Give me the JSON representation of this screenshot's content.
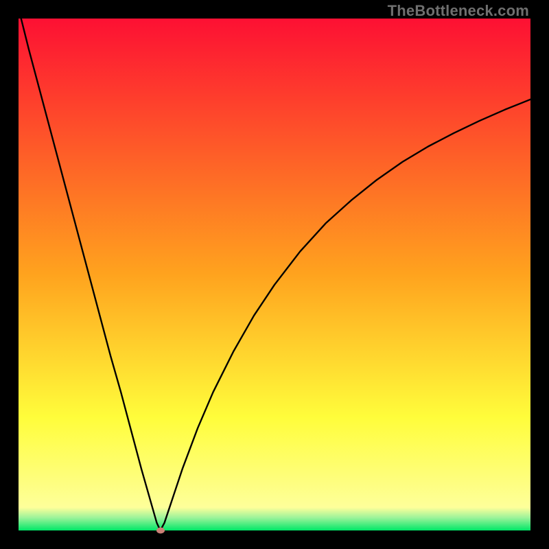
{
  "watermark": "TheBottleneck.com",
  "chart_data": {
    "type": "line",
    "title": "",
    "xlabel": "",
    "ylabel": "",
    "xlim": [
      0,
      100
    ],
    "ylim": [
      0,
      100
    ],
    "grid": false,
    "legend": false,
    "background": {
      "gradient_stops": [
        {
          "pos": 0.0,
          "color": "#fd1033"
        },
        {
          "pos": 0.5,
          "color": "#ffa31e"
        },
        {
          "pos": 0.78,
          "color": "#fffd3b"
        },
        {
          "pos": 0.955,
          "color": "#feff9a"
        },
        {
          "pos": 0.975,
          "color": "#9cf39a"
        },
        {
          "pos": 1.0,
          "color": "#00e767"
        }
      ]
    },
    "series": [
      {
        "name": "bottleneck-curve",
        "color": "#000000",
        "x": [
          0,
          2,
          4,
          6,
          8,
          10,
          12,
          14,
          16,
          18,
          20,
          22,
          24,
          26,
          27,
          27.7,
          28.5,
          30,
          32,
          35,
          38,
          42,
          46,
          50,
          55,
          60,
          65,
          70,
          75,
          80,
          85,
          90,
          95,
          100
        ],
        "y": [
          102,
          94,
          86.5,
          79,
          71.5,
          64,
          56.5,
          49,
          41.5,
          34,
          27,
          19.5,
          12,
          5,
          1.5,
          0,
          1.5,
          6,
          12,
          20,
          27,
          35,
          42,
          48,
          54.5,
          60,
          64.5,
          68.5,
          72,
          75,
          77.6,
          80,
          82.2,
          84.2
        ]
      }
    ],
    "marker": {
      "name": "trough-marker",
      "x": 27.7,
      "y": 0,
      "color": "#cc8077"
    }
  }
}
